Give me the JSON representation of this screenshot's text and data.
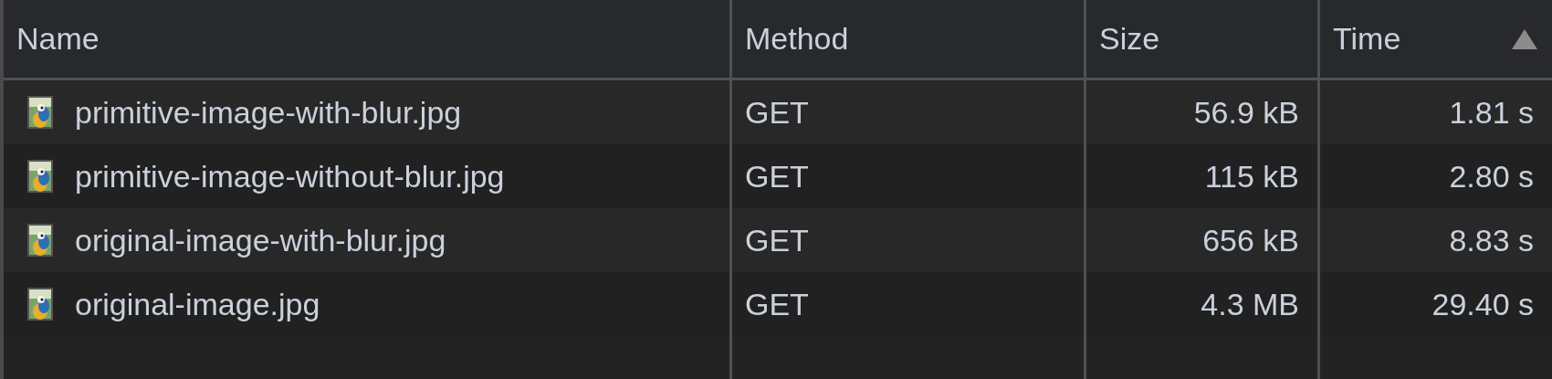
{
  "table": {
    "columns": [
      {
        "label": "Name",
        "sorted": false
      },
      {
        "label": "Method",
        "sorted": false
      },
      {
        "label": "Size",
        "sorted": false
      },
      {
        "label": "Time",
        "sorted": true
      }
    ],
    "rows": [
      {
        "name": "primitive-image-with-blur.jpg",
        "method": "GET",
        "size": "56.9 kB",
        "time": "1.81 s"
      },
      {
        "name": "primitive-image-without-blur.jpg",
        "method": "GET",
        "size": "115 kB",
        "time": "2.80 s"
      },
      {
        "name": "original-image-with-blur.jpg",
        "method": "GET",
        "size": "656 kB",
        "time": "8.83 s"
      },
      {
        "name": "original-image.jpg",
        "method": "GET",
        "size": "4.3 MB",
        "time": "29.40 s"
      }
    ]
  }
}
